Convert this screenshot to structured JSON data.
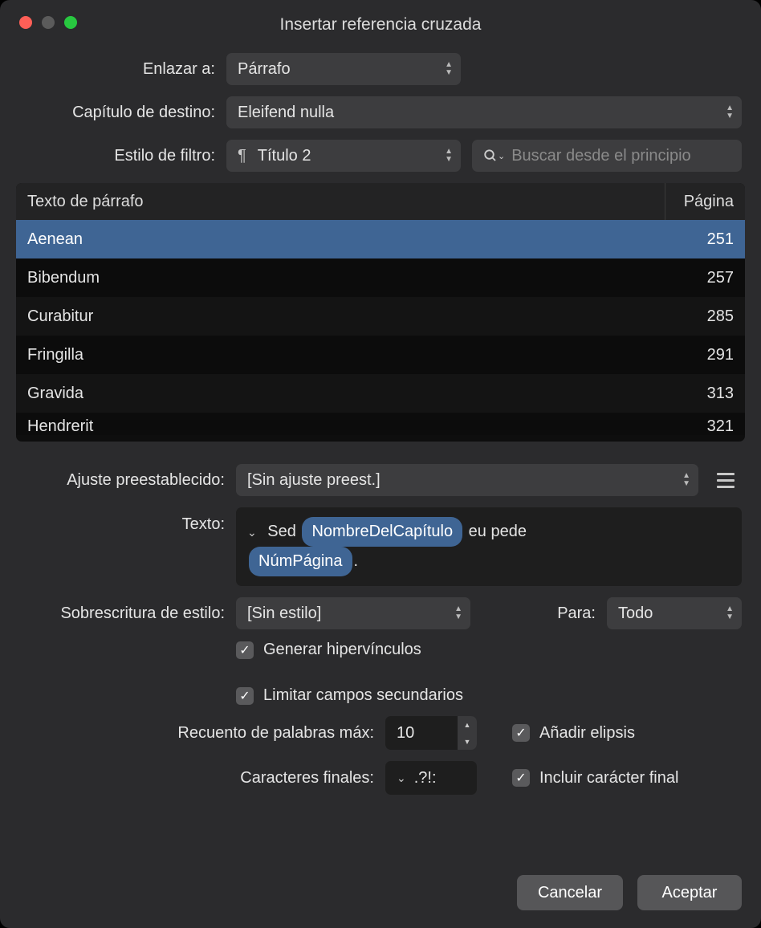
{
  "window": {
    "title": "Insertar referencia cruzada"
  },
  "labels": {
    "link_to": "Enlazar a:",
    "dest_chapter": "Capítulo de destino:",
    "filter_style": "Estilo de filtro:",
    "preset": "Ajuste preestablecido:",
    "text": "Texto:",
    "style_override": "Sobrescritura de estilo:",
    "for": "Para:",
    "max_words": "Recuento de palabras máx:",
    "final_chars": "Caracteres finales:"
  },
  "selects": {
    "link_to": "Párrafo",
    "dest_chapter": "Eleifend nulla",
    "filter_style": "Título 2",
    "preset": "[Sin ajuste preest.]",
    "style_override": "[Sin estilo]",
    "for": "Todo"
  },
  "search": {
    "placeholder": "Buscar desde el principio"
  },
  "table": {
    "col_text": "Texto de párrafo",
    "col_page": "Página",
    "rows": [
      {
        "text": "Aenean",
        "page": "251",
        "selected": true
      },
      {
        "text": "Bibendum",
        "page": "257"
      },
      {
        "text": "Curabitur",
        "page": "285"
      },
      {
        "text": "Fringilla",
        "page": "291"
      },
      {
        "text": "Gravida",
        "page": "313"
      },
      {
        "text": "Hendrerit",
        "page": "321"
      }
    ]
  },
  "text_template": {
    "prefix": "Sed ",
    "token1": "NombreDelCapítulo",
    "mid": " eu pede ",
    "token2": "NúmPágina",
    "suffix": "."
  },
  "checks": {
    "hyperlinks": "Generar hipervínculos",
    "limit_secondary": "Limitar campos secundarios",
    "ellipsis": "Añadir elipsis",
    "include_final": "Incluir carácter final"
  },
  "values": {
    "max_words": "10",
    "final_chars": ".?!:"
  },
  "buttons": {
    "cancel": "Cancelar",
    "accept": "Aceptar"
  }
}
